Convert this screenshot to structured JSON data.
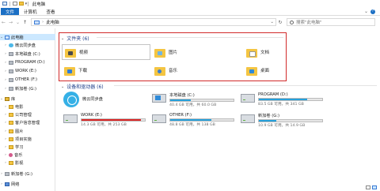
{
  "window": {
    "title": "此电脑"
  },
  "ribbon": {
    "tabs": [
      "文件",
      "计算机",
      "查看"
    ]
  },
  "address": {
    "path": "此电脑",
    "search_placeholder": "搜索\"此电脑\""
  },
  "sidebar": {
    "items": [
      {
        "label": "此电脑",
        "icon": "computer-icon",
        "selected": true
      },
      {
        "label": "微云同步盘",
        "icon": "cloud-icon"
      },
      {
        "label": "本地磁盘 (C:)",
        "icon": "drive-icon"
      },
      {
        "label": "PROGRAM (D:)",
        "icon": "drive-icon"
      },
      {
        "label": "WORK (E:)",
        "icon": "drive-icon"
      },
      {
        "label": "OTHER (F:)",
        "icon": "drive-icon"
      },
      {
        "label": "新加卷 (G:)",
        "icon": "drive-icon"
      },
      {
        "label": "库",
        "icon": "library-icon"
      },
      {
        "label": "电影",
        "icon": "folder-icon"
      },
      {
        "label": "公司管理",
        "icon": "folder-icon"
      },
      {
        "label": "客户信息管理",
        "icon": "folder-icon"
      },
      {
        "label": "图片",
        "icon": "folder-icon"
      },
      {
        "label": "项目实施",
        "icon": "folder-icon"
      },
      {
        "label": "学习",
        "icon": "folder-icon"
      },
      {
        "label": "音乐",
        "icon": "music-icon"
      },
      {
        "label": "影视",
        "icon": "folder-icon"
      },
      {
        "label": "新加卷 (G:)",
        "icon": "drive-icon"
      },
      {
        "label": "网络",
        "icon": "network-icon"
      }
    ]
  },
  "folders": {
    "heading": "文件夹 (6)",
    "items": [
      {
        "label": "视频",
        "icon": "video-folder-icon"
      },
      {
        "label": "图片",
        "icon": "pictures-folder-icon"
      },
      {
        "label": "文档",
        "icon": "documents-folder-icon"
      },
      {
        "label": "下载",
        "icon": "downloads-folder-icon"
      },
      {
        "label": "音乐",
        "icon": "music-folder-icon"
      },
      {
        "label": "桌面",
        "icon": "desktop-folder-icon"
      }
    ]
  },
  "devices": {
    "heading": "设备和驱动器 (6)",
    "items": [
      {
        "name": "微云同步盘",
        "icon": "weiyun-icon"
      },
      {
        "name": "本地磁盘 (C:)",
        "free": "40.4 GB 可用，共 60.0 GB",
        "used_fraction": 0.33,
        "icon": "windows-drive-icon"
      },
      {
        "name": "PROGRAM (D:)",
        "free": "83.5 GB 可用，共 341 GB",
        "used_fraction": 0.76,
        "icon": "drive-icon"
      },
      {
        "name": "WORK (E:)",
        "free": "14.3 GB 可用，共 253 GB",
        "used_fraction": 0.94,
        "icon": "drive-icon"
      },
      {
        "name": "OTHER (F:)",
        "free": "48.8 GB 可用，共 138 GB",
        "used_fraction": 0.65,
        "icon": "drive-icon"
      },
      {
        "name": "新加卷 (G:)",
        "free": "10.9 GB 可用，共 14.9 GB",
        "used_fraction": 0.27,
        "icon": "drive-icon"
      }
    ]
  },
  "colors": {
    "accent": "#1b6fc4",
    "highlight_box": "#d12a2a",
    "bar_normal": "#26a0da",
    "bar_full": "#da2626"
  }
}
